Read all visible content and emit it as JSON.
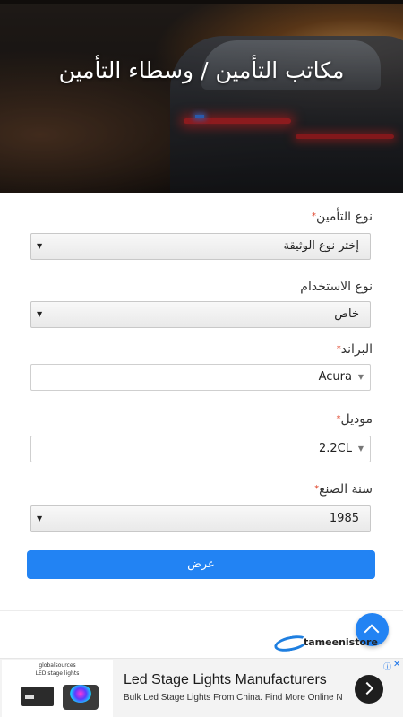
{
  "hero": {
    "title": "مكاتب التأمين / وسطاء التأمين"
  },
  "form": {
    "insurance_type": {
      "label": "نوع التأمين",
      "required_mark": "*",
      "value": "إختر نوع الوثيقة"
    },
    "usage_type": {
      "label": "نوع الاستخدام",
      "value": "خاص"
    },
    "brand": {
      "label": "البراند",
      "required_mark": "*",
      "value": "Acura"
    },
    "model": {
      "label": "موديل",
      "required_mark": "*",
      "value": "2.2CL"
    },
    "year": {
      "label": "سنة الصنع",
      "required_mark": "*",
      "value": "1985"
    },
    "submit_label": "عرض"
  },
  "footer": {
    "logo_text": "tameenistore"
  },
  "ad": {
    "thumb_brand": "globalsources",
    "thumb_title": "LED stage lights",
    "title": "Led Stage Lights Manufacturers",
    "description": "Bulk Led Stage Lights From China. Find More Online N"
  },
  "colors": {
    "accent": "#2283f3",
    "required": "#e0452b"
  },
  "icons": {
    "scroll_top": "chevron-up-icon",
    "ad_next": "chevron-right-icon",
    "ad_info": "info-icon",
    "ad_close": "close-icon"
  }
}
